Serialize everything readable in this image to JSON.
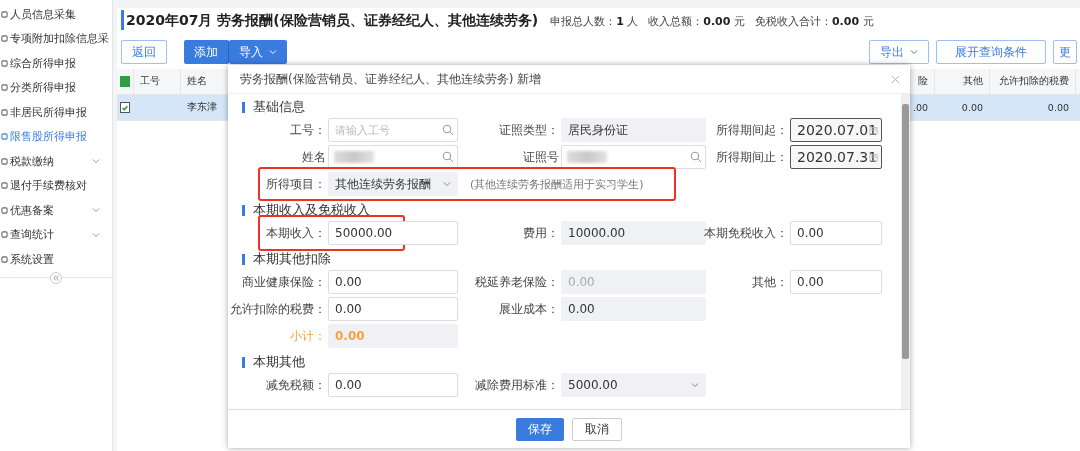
{
  "sidebar": {
    "items": [
      {
        "label": "人员信息采集",
        "selected": false,
        "expandable": false
      },
      {
        "label": "专项附加扣除信息采",
        "selected": false,
        "expandable": false
      },
      {
        "label": "综合所得申报",
        "selected": false,
        "expandable": false
      },
      {
        "label": "分类所得申报",
        "selected": false,
        "expandable": false
      },
      {
        "label": "非居民所得申报",
        "selected": false,
        "expandable": false
      },
      {
        "label": "限售股所得申报",
        "selected": true,
        "expandable": false
      },
      {
        "label": "税款缴纳",
        "selected": false,
        "expandable": true
      },
      {
        "label": "退付手续费核对",
        "selected": false,
        "expandable": false
      },
      {
        "label": "优惠备案",
        "selected": false,
        "expandable": true
      },
      {
        "label": "查询统计",
        "selected": false,
        "expandable": true
      },
      {
        "label": "系统设置",
        "selected": false,
        "expandable": false
      }
    ]
  },
  "page": {
    "title": "2020年07月 劳务报酬(保险营销员、证券经纪人、其他连续劳务)",
    "summary": [
      {
        "label": "申报总人数：",
        "value": "1",
        "unit": "人"
      },
      {
        "label": "收入总额：",
        "value": "0.00",
        "unit": "元"
      },
      {
        "label": "免税收入合计：",
        "value": "0.00",
        "unit": "元"
      }
    ]
  },
  "toolbar": {
    "left": [
      {
        "label": "返回",
        "kind": "outline",
        "dropdown": false
      },
      {
        "label": "添加",
        "kind": "primary",
        "dropdown": false
      },
      {
        "label": "导入",
        "kind": "primary",
        "dropdown": true
      }
    ],
    "right": [
      {
        "label": "导出",
        "kind": "outline",
        "dropdown": true
      },
      {
        "label": "展开查询条件",
        "kind": "outline",
        "dropdown": false
      },
      {
        "label": "更",
        "kind": "outline",
        "dropdown": false
      }
    ]
  },
  "table": {
    "header_checked": true,
    "columns": [
      "工号",
      "姓名",
      "",
      "险",
      "其他",
      "允许扣除的税费",
      ""
    ],
    "rows": [
      {
        "selected": true,
        "checked": true,
        "cells": [
          "",
          "李东津",
          "",
          ".00",
          "0.00",
          "0.00",
          ""
        ]
      }
    ]
  },
  "dialog": {
    "title": "劳务报酬(保险营销员、证券经纪人、其他连续劳务) 新增",
    "sections": [
      {
        "title": "基础信息",
        "rows": [
          {
            "highlighted": false,
            "fields": [
              {
                "label": "工号：",
                "kind": "search",
                "placeholder": "请输入工号",
                "redacted": false,
                "highlighted": false
              },
              {
                "label": "证照类型：",
                "kind": "readonly",
                "value": "居民身份证",
                "disabled": false,
                "highlighted": false
              },
              {
                "label": "所得期间起：",
                "kind": "date",
                "value": "2020.07.01",
                "highlighted": false
              }
            ]
          },
          {
            "highlighted": false,
            "fields": [
              {
                "label": "姓名",
                "kind": "search",
                "redacted": true,
                "highlighted": false
              },
              {
                "label": "证照号",
                "kind": "search",
                "redacted": true,
                "highlighted": false
              },
              {
                "label": "所得期间止：",
                "kind": "date",
                "value": "2020.07.31",
                "highlighted": false
              }
            ]
          },
          {
            "highlighted": true,
            "note": "(其他连续劳务报酬适用于实习学生)",
            "fields": [
              {
                "label": "所得项目：",
                "kind": "select",
                "value": "其他连续劳务报酬",
                "highlighted": false
              }
            ]
          }
        ]
      },
      {
        "title": "本期收入及免税收入",
        "rows": [
          {
            "highlighted": false,
            "fields": [
              {
                "label": "本期收入：",
                "kind": "text",
                "value": "50000.00",
                "highlighted": true
              },
              {
                "label": "费用：",
                "kind": "readonly",
                "value": "10000.00",
                "disabled": false,
                "highlighted": false
              },
              {
                "label": "本期免税收入：",
                "kind": "text",
                "value": "0.00",
                "highlighted": false
              }
            ]
          }
        ]
      },
      {
        "title": "本期其他扣除",
        "rows": [
          {
            "highlighted": false,
            "fields": [
              {
                "label": "商业健康保险：",
                "kind": "text",
                "value": "0.00",
                "highlighted": false
              },
              {
                "label": "税延养老保险：",
                "kind": "readonly",
                "value": "0.00",
                "disabled": true,
                "highlighted": false
              },
              {
                "label": "其他：",
                "kind": "text",
                "value": "0.00",
                "highlighted": false
              }
            ]
          },
          {
            "highlighted": false,
            "fields": [
              {
                "label": "允许扣除的税费：",
                "kind": "text",
                "value": "0.00",
                "highlighted": false
              },
              {
                "label": "展业成本：",
                "kind": "readonly",
                "value": "0.00",
                "disabled": false,
                "highlighted": false
              }
            ]
          },
          {
            "highlighted": false,
            "fields": [
              {
                "label": "小计：",
                "kind": "subtotal",
                "value": "0.00",
                "highlighted": false
              }
            ]
          }
        ]
      },
      {
        "title": "本期其他",
        "rows": [
          {
            "highlighted": false,
            "fields": [
              {
                "label": "减免税额：",
                "kind": "text",
                "value": "0.00",
                "highlighted": false
              },
              {
                "label": "减除费用标准：",
                "kind": "select",
                "value": "5000.00",
                "highlighted": false
              }
            ]
          }
        ]
      }
    ],
    "buttons": [
      {
        "label": "保存",
        "kind": "primary"
      },
      {
        "label": "取消",
        "kind": "outline"
      }
    ]
  }
}
